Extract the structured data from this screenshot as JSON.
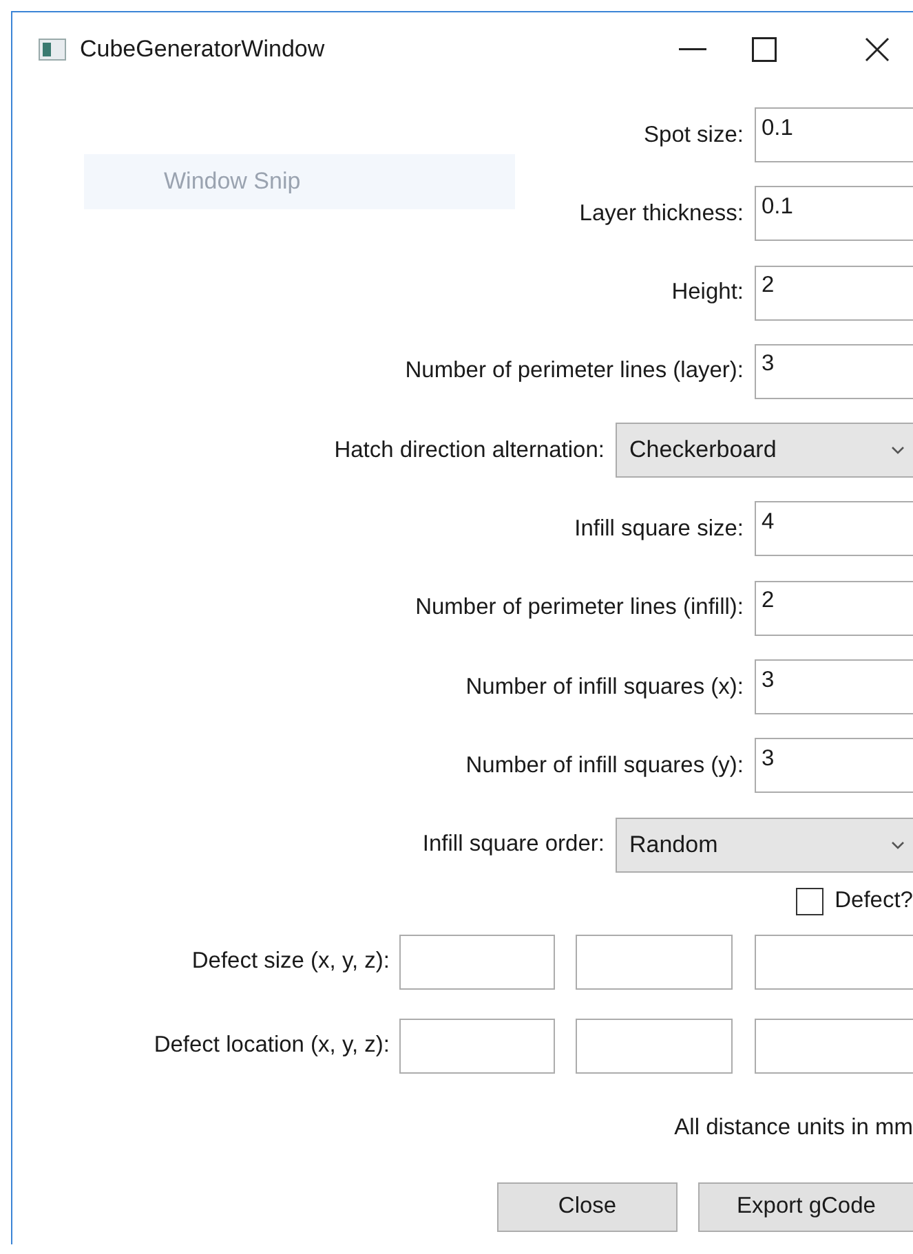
{
  "window": {
    "title": "CubeGeneratorWindow"
  },
  "snip_tooltip": "Window Snip",
  "rows": [
    {
      "kind": "text",
      "label": "Spot size:",
      "value": "0.1"
    },
    {
      "kind": "text",
      "label": "Layer thickness:",
      "value": "0.1"
    },
    {
      "kind": "text",
      "label": "Height:",
      "value": "2"
    },
    {
      "kind": "text",
      "label": "Number of perimeter lines (layer):",
      "value": "3"
    },
    {
      "kind": "combo",
      "label": "Hatch direction alternation:",
      "value": "Checkerboard"
    },
    {
      "kind": "text",
      "label": "Infill square size:",
      "value": "4"
    },
    {
      "kind": "text",
      "label": "Number of perimeter lines (infill):",
      "value": "2"
    },
    {
      "kind": "text",
      "label": "Number of infill squares (x):",
      "value": "3"
    },
    {
      "kind": "text",
      "label": "Number of infill squares (y):",
      "value": "3"
    },
    {
      "kind": "combo",
      "label": "Infill square order:",
      "value": "Random"
    }
  ],
  "defect": {
    "label": "Defect?",
    "checked": false
  },
  "triples": [
    {
      "label": "Defect size (x, y, z):"
    },
    {
      "label": "Defect location (x, y, z):"
    }
  ],
  "note": "All distance units in mm",
  "buttons": [
    "Close",
    "Export gCode"
  ]
}
